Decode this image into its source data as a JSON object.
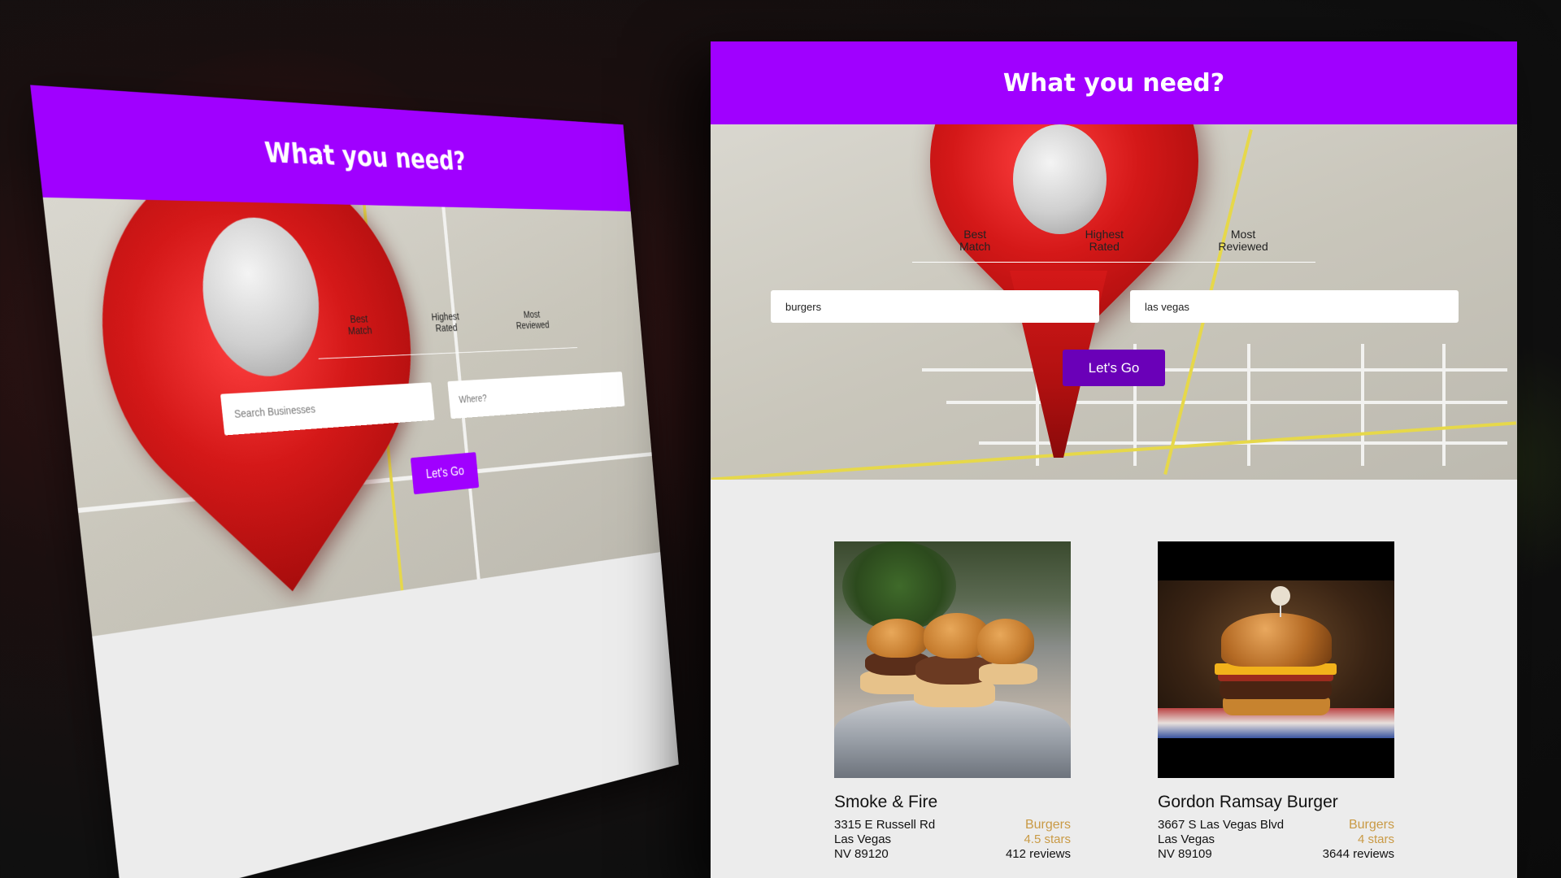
{
  "back_mockup": {
    "header_title": "What you need?",
    "tabs": [
      {
        "label_line1": "Best",
        "label_line2": "Match"
      },
      {
        "label_line1": "Highest",
        "label_line2": "Rated"
      },
      {
        "label_line1": "Most",
        "label_line2": "Reviewed"
      }
    ],
    "search_placeholder": "Search Businesses",
    "location_placeholder": "Where?",
    "button_label": "Let's Go",
    "accent_color": "#a000ff"
  },
  "front_mockup": {
    "header_title": "What you need?",
    "tabs": [
      {
        "label_line1": "Best",
        "label_line2": "Match"
      },
      {
        "label_line1": "Highest",
        "label_line2": "Rated"
      },
      {
        "label_line1": "Most",
        "label_line2": "Reviewed"
      }
    ],
    "search_value": "burgers",
    "location_value": "las vegas",
    "button_label": "Let's Go",
    "accent_color": "#a000ff",
    "button_color": "#6a00b8",
    "businesses": [
      {
        "name": "Smoke & Fire",
        "address1": "3315 E Russell Rd",
        "address2": "Las Vegas",
        "address3": "NV 89120",
        "category": "Burgers",
        "rating": "4.5 stars",
        "reviews": "412 reviews"
      },
      {
        "name": "Gordon Ramsay Burger",
        "address1": "3667 S Las Vegas Blvd",
        "address2": "Las Vegas",
        "address3": "NV 89109",
        "category": "Burgers",
        "rating": "4 stars",
        "reviews": "3644 reviews"
      }
    ]
  }
}
